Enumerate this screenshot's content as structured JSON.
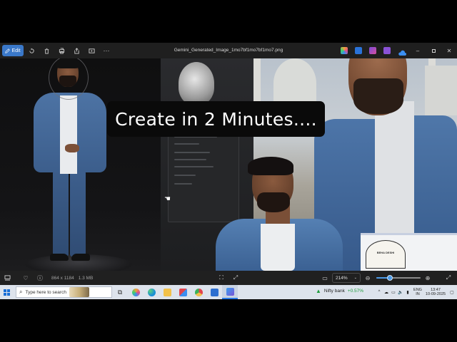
{
  "toolbar": {
    "edit_label": "Edit",
    "file_title": "Gemini_Generated_Image_1mo7bf1mo7bf1mo7.png",
    "icons": [
      "rotate-icon",
      "delete-icon",
      "print-icon",
      "share-icon",
      "slideshow-icon",
      "more-icon"
    ],
    "window_controls": [
      "minimize",
      "maximize",
      "close"
    ]
  },
  "overlay": {
    "headline": "Create in 2 Minutes...."
  },
  "product_box": {
    "brand_text": "BEHA DESHI"
  },
  "statusbar": {
    "dimensions": "864 x 1184",
    "file_size": "1.3 MB",
    "zoom_value": "214%",
    "zoom_level": 0.3
  },
  "taskbar": {
    "search_placeholder": "Type here to search",
    "widget_name": "Nifty bank",
    "widget_value": "+0.57%",
    "lang_top": "ENG",
    "lang_bottom": "IN",
    "time": "13:47",
    "date": "10-09-2025"
  },
  "colors": {
    "accent": "#3a78c9",
    "zoom_accent": "#4c9be8",
    "taskbar_bg": "#dde3ec",
    "positive": "#1e9c3c"
  }
}
